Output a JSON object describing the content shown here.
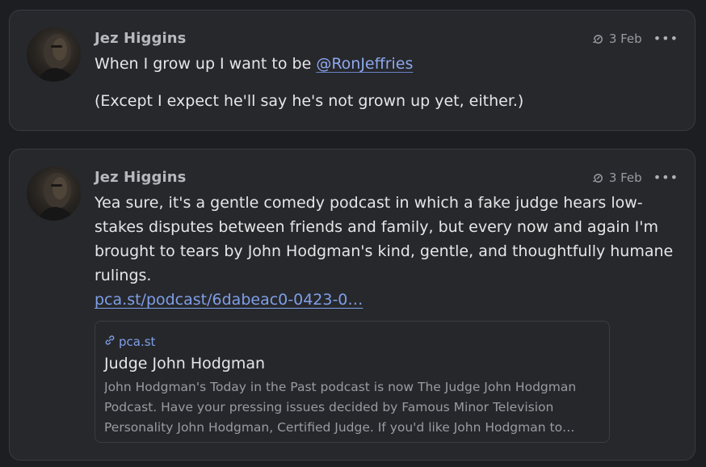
{
  "posts": [
    {
      "author": "Jez Higgins",
      "date": "3 Feb",
      "more": "•••",
      "text_before_mention": "When I grow up I want to be ",
      "mention": "@RonJeffries",
      "paragraph2": "(Except I expect he'll say he's not grown up yet, either.)"
    },
    {
      "author": "Jez Higgins",
      "date": "3 Feb",
      "more": "•••",
      "text": "Yea sure, it's a gentle comedy podcast in which a fake judge hears low-stakes disputes between friends and family, but every now and again I'm brought to tears by John Hodgman's kind, gentle, and thoughtfully humane rulings.",
      "link": "pca.st/podcast/6dabeac0-0423-0…",
      "card": {
        "domain": "pca.st",
        "title": "Judge John Hodgman",
        "description": "John Hodgman's Today in the Past podcast is now The Judge John Hodgman Podcast. Have your pressing issues decided by Famous Minor Television Personality John Hodgman, Certified Judge. If you'd like John Hodgman to…"
      }
    }
  ],
  "icons": {
    "edited": "edit-history-icon",
    "more": "more-options-icon",
    "link": "link-icon"
  },
  "colors": {
    "background": "#1d1e22",
    "card": "#27282c",
    "accent_link": "#7f9fe8",
    "author": "#b7b8bd"
  }
}
